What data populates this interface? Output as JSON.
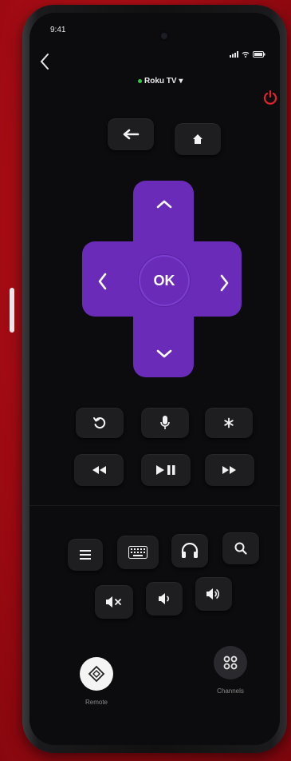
{
  "status_bar": {
    "time": "9:41",
    "icons": [
      "signal-icon",
      "wifi-icon",
      "battery-icon"
    ]
  },
  "header": {
    "back_icon": "chevron-left-icon",
    "device_name": "Roku TV",
    "device_status_color": "#2ecc40",
    "power_icon": "power-icon",
    "power_color": "#e0242c"
  },
  "nav_row": {
    "back_icon": "arrow-left-icon",
    "home_icon": "home-icon"
  },
  "dpad": {
    "ok_label": "OK",
    "color": "#6a2cb8",
    "up_icon": "chevron-up-icon",
    "down_icon": "chevron-down-icon",
    "left_icon": "chevron-left-icon",
    "right_icon": "chevron-right-icon"
  },
  "control_rows": [
    [
      "replay-icon",
      "microphone-icon",
      "asterisk-icon"
    ],
    [
      "rewind-icon",
      "play-pause-icon",
      "fast-forward-icon"
    ]
  ],
  "tools_row": [
    "menu-icon",
    "keyboard-icon",
    "headphones-icon",
    "search-icon"
  ],
  "volume_row": [
    "volume-mute-icon",
    "volume-down-icon",
    "volume-up-icon"
  ],
  "tabs": [
    {
      "label": "Remote",
      "icon": "remote-icon",
      "active": true
    },
    {
      "label": "Channels",
      "icon": "channels-icon",
      "active": false
    }
  ]
}
